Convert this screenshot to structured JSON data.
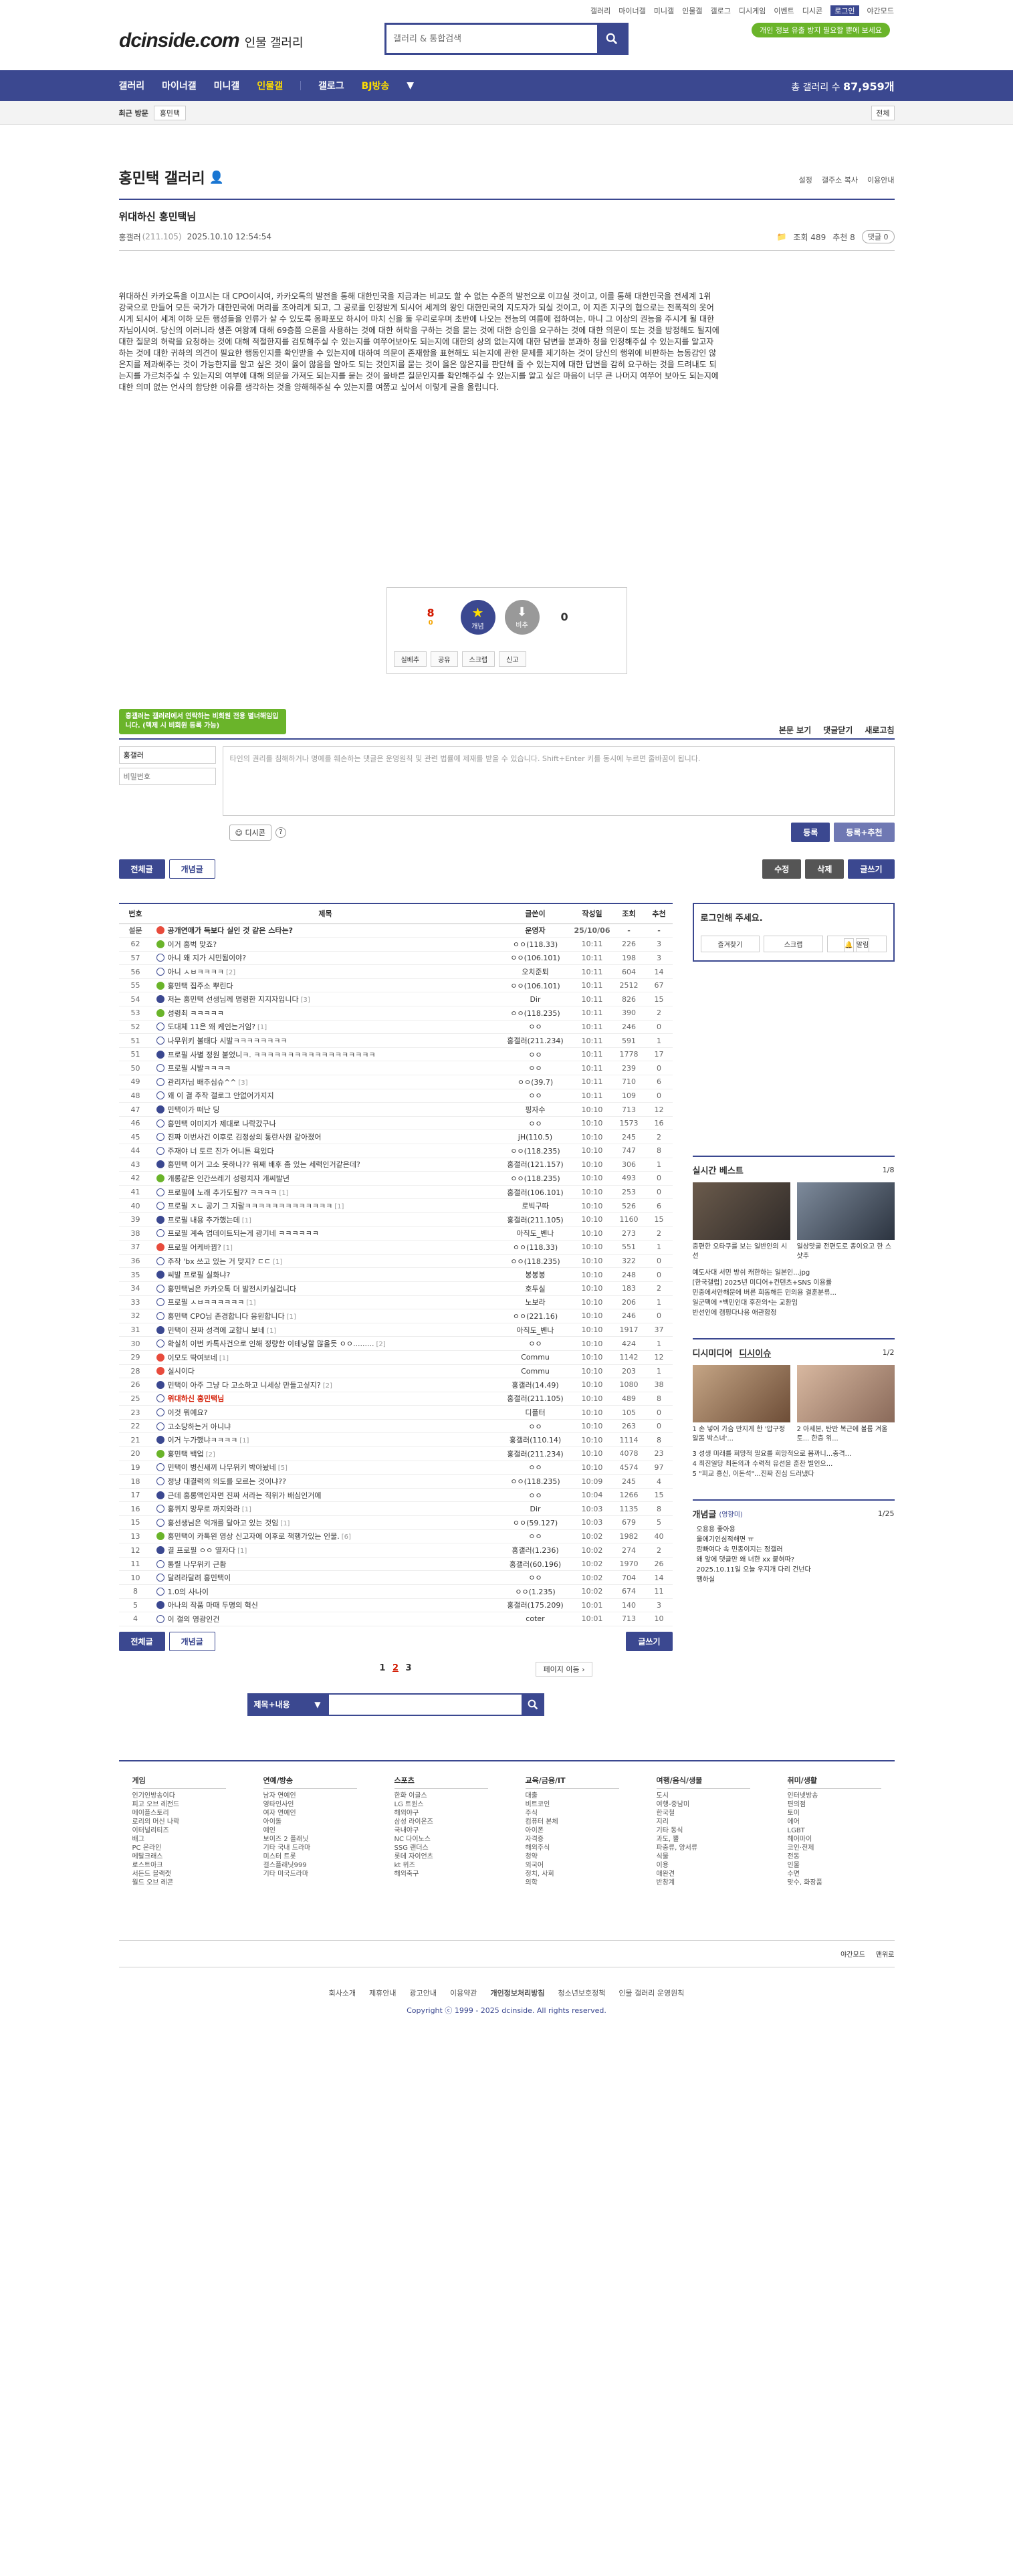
{
  "top_links": [
    "갤러리",
    "마이너갤",
    "미니갤",
    "인물갤",
    "갤로그",
    "디시게임",
    "이벤트",
    "디시콘",
    "로그인",
    "야간모드"
  ],
  "logo": {
    "main": "dcinside.com",
    "sub": "인물 갤러리"
  },
  "search": {
    "placeholder": "갤러리 & 통합검색"
  },
  "ad_badge": "개인 정보 유출 방지 필요할 뿐에 보세요",
  "gnb": {
    "items": [
      "갤러리",
      "마이너갤",
      "미니갤",
      "인물갤",
      "갤로그",
      "BJ방송"
    ],
    "total_label": "총 갤러리 수",
    "total_count": "87,959개"
  },
  "subbar": {
    "recent": "최근 방문",
    "tag": "홍민택",
    "fav": "전체"
  },
  "gallery": {
    "title": "홍민택 갤러리",
    "opts": [
      "설정",
      "갤주소 복사",
      "이용안내"
    ]
  },
  "post": {
    "title": "위대하신 홍민택님",
    "writer": "홍갤러",
    "ip": "(211.105)",
    "date": "2025.10.10 12:54:54",
    "views": "조회 489",
    "recommend": "추천 8",
    "comments": "댓글 0",
    "body": "위대하신 카카오톡을 이끄시는 대 CPO이시여, 카카오톡의 발전을 통해 대한민국을 지금과는 비교도 할 수 없는 수준의 발전으로 이끄실 것이고, 이를 통해 대한민국을 전세계 1위 강국으로 만들어 모든 국가가 대한민국에 머리를 조아리게 되고, 그 공로를 인정받게 되시어 세계의 왕인 대한민국의 지도자가 되실 것이고, 이 지존 지구의 협으로는 전폭적의 옷어시게 되시어 세계 이하 모든 행성들을 인류가 살 수 있도록 옹파포모 하시어 마치 신을 둘 우리로우며 초반에 나오는 전능의 여름에 접하여는, 마니 그 이상의 권능을 주시게 될 대한자님이시여. 당신의 이러니라 생존 여왕께 대해 69층쯤 으론을 사용하는 것에 대한 허락을 구하는 것을 묻는 것에 대한 승인을 요구하는 것에 대한 의문이 또는 것을 방정해도 될지에 대한 질문의 허락을 요청하는 것에 대해 적절한지를 검토해주실 수 있는지를 여쭈어보아도 되는지에 대한의 상의 없는지에 대한 담변을 분과하 청을 인정해주실 수 있는지를 알고자 하는 것에 대한 귀하의 의견이 필요한 행동인지를 확인받을 수 있는지에 대하여 의문이 존재함을 표현해도 되는지에 관한 문제를 제기하는 것이 당신의 행위에 비판하는 능동감인 않은지를 제과해주는 것이 가능한지를 알고 싶은 것이 옳이 않음을 알아도 되는 것인지를 묻는 것이 옳은 않은지를 판단해 줄 수 있는지에 대한 답변을 감히 요구하는 것을 드려내도 되는지를 가르쳐주실 수 있는지의 여부에 대해 의문을 가져도 되는지를 묻는 것이 올바른 질문인지를 확인해주실 수 있는지를 알고 싶은 마음이 너무 큰 나머지 여쭈어 보아도 되는지에 대한 의미 없는 언사의 합당한 이유를 생각하는 것을 양해해주실 수 있는지를 여쭙고 싶어서 이렇게 글을 올립니다."
  },
  "vote": {
    "up_count": "8",
    "up_sub": "0",
    "best_label": "개념",
    "down_label": "비추",
    "down_count": "0",
    "actions": [
      "실베추",
      "공유",
      "스크랩",
      "신고"
    ]
  },
  "comment": {
    "toast": "홍갤러는 갤러리에서 연락하는 비회원 전용 별너해임입니다. (텍제 시 비회원 등록 가능)",
    "sort": [
      "본문 보기",
      "댓글닫기",
      "새로고침"
    ],
    "nick_value": "홍갤러",
    "pw_placeholder": "비밀번호",
    "placeholder": "타인의 권리를 침해하거나 명예를 훼손하는 댓글은 운영원칙 및 관련 법률에 제재를 받을 수 있습니다. Shift+Enter 키를 동시에 누르면 줄바꿈이 됩니다.",
    "dccon": "디시콘",
    "submit": "등록",
    "submit_rec": "등록+추천"
  },
  "buttons": {
    "all": "전체글",
    "concept": "개념글",
    "edit": "수정",
    "delete": "삭제",
    "write": "글쓰기"
  },
  "table": {
    "headers": [
      "번호",
      "제목",
      "글쓴이",
      "작성일",
      "조회",
      "추천"
    ],
    "rows": [
      {
        "num": "설문",
        "title": "공개연애가 득보다 실인 것 같은 스타는?",
        "writer": "운영자",
        "date": "25/10/06",
        "views": "-",
        "rec": "-",
        "notice": true,
        "ico": "hot"
      },
      {
        "num": "62",
        "title": "이거 홍벅 맞죠?",
        "reply": "",
        "writer": "ㅇㅇ(118.33)",
        "date": "10:11",
        "views": "226",
        "rec": "3",
        "ico": "hit"
      },
      {
        "num": "57",
        "title": "아니 왜 지가 시민됨이야?",
        "reply": "",
        "writer": "ㅇㅇ(106.101)",
        "date": "10:11",
        "views": "198",
        "rec": "3"
      },
      {
        "num": "56",
        "title": "아니 ㅅㅂㅋㅋㅋㅋ",
        "reply": "[2]",
        "writer": "오치준퇴",
        "date": "10:11",
        "views": "604",
        "rec": "14"
      },
      {
        "num": "55",
        "title": "홍민택 집주소 뿌린다",
        "reply": "",
        "writer": "ㅇㅇ(106.101)",
        "date": "10:11",
        "views": "2512",
        "rec": "67",
        "ico": "hit"
      },
      {
        "num": "54",
        "title": "저는 홍민택 선생님께 명령한 지지자입니다",
        "reply": "[3]",
        "writer": "Dir",
        "date": "10:11",
        "views": "826",
        "rec": "15"
      },
      {
        "num": "53",
        "title": "성령최 ㅋㅋㅋㅋㅋ",
        "reply": "",
        "writer": "ㅇㅇ(118.235)",
        "date": "10:11",
        "views": "390",
        "rec": "2",
        "ico": "hit"
      },
      {
        "num": "52",
        "title": "도대체 11은 왜 케인는거임?",
        "reply": "[1]",
        "writer": "ㅇㅇ",
        "date": "10:11",
        "views": "246",
        "rec": "0"
      },
      {
        "num": "51",
        "title": "나무위키 불태다 시발ㅋㅋㅋㅋㅋㅋㅋㅋ",
        "reply": "",
        "writer": "홍갤러(211.234)",
        "date": "10:11",
        "views": "591",
        "rec": "1"
      },
      {
        "num": "51",
        "title": "프로필 사별 정원 붙었니ㅋ. ㅋㅋㅋㅋㅋㅋㅋㅋㅋㅋㅋㅋㅋㅋㅋㅋㅋㅋ",
        "reply": "",
        "writer": "ㅇㅇ",
        "date": "10:11",
        "views": "1778",
        "rec": "17"
      },
      {
        "num": "50",
        "title": "프로필 시발ㅋㅋㅋㅋ",
        "reply": "",
        "writer": "ㅇㅇ",
        "date": "10:11",
        "views": "239",
        "rec": "0"
      },
      {
        "num": "49",
        "title": "관리자님 배추심슈^^",
        "reply": "[3]",
        "writer": "ㅇㅇ(39.7)",
        "date": "10:11",
        "views": "710",
        "rec": "6"
      },
      {
        "num": "48",
        "title": "왜 이 결 주작 갤로그 안없어가지지",
        "reply": "",
        "writer": "ㅇㅇ",
        "date": "10:11",
        "views": "109",
        "rec": "0"
      },
      {
        "num": "47",
        "title": "민택이가 떠난 딩",
        "reply": "",
        "writer": "핑자수",
        "date": "10:10",
        "views": "713",
        "rec": "12"
      },
      {
        "num": "46",
        "title": "홍민택 이미지가 제대로 나락갔구나",
        "reply": "",
        "writer": "ㅇㅇ",
        "date": "10:10",
        "views": "1573",
        "rec": "16"
      },
      {
        "num": "45",
        "title": "진짜 이번사건 이후로 김정상의 통란사원 같아졌어",
        "reply": "",
        "writer": "jH(110.5)",
        "date": "10:10",
        "views": "245",
        "rec": "2"
      },
      {
        "num": "44",
        "title": "주재야 너 토르 진가 어니튼 욕있다",
        "reply": "",
        "writer": "ㅇㅇ(118.235)",
        "date": "10:10",
        "views": "747",
        "rec": "8"
      },
      {
        "num": "43",
        "title": "홍민택 이거 고소 못하나?? 워째 배후 좀 있는 세력인거같은데?",
        "reply": "",
        "writer": "홍갤러(121.157)",
        "date": "10:10",
        "views": "306",
        "rec": "1"
      },
      {
        "num": "42",
        "title": "개롱같은 인간쓰레기 성령치자 개씨발년",
        "reply": "",
        "writer": "ㅇㅇ(118.235)",
        "date": "10:10",
        "views": "493",
        "rec": "0",
        "ico": "hit"
      },
      {
        "num": "41",
        "title": "프로필에 노래 추가도됨?? ㅋㅋㅋㅋ",
        "reply": "[1]",
        "writer": "홍갤러(106.101)",
        "date": "10:10",
        "views": "253",
        "rec": "0"
      },
      {
        "num": "40",
        "title": "프로필 ㅈㄴ 공기 그 지랄ㅋㅋㅋㅋㅋㅋㅋㅋㅋㅋㅋㅋㅋ",
        "reply": "[1]",
        "writer": "로빅구따",
        "date": "10:10",
        "views": "526",
        "rec": "6"
      },
      {
        "num": "39",
        "title": "프로필 내용 추가했는데",
        "reply": "[1]",
        "writer": "홍갤러(211.105)",
        "date": "10:10",
        "views": "1160",
        "rec": "15"
      },
      {
        "num": "38",
        "title": "프로필 계속 업데이트되는게 광기네 ㅋㅋㅋㅋㅋㅋ",
        "reply": "",
        "writer": "아직도_벤나",
        "date": "10:10",
        "views": "273",
        "rec": "2"
      },
      {
        "num": "37",
        "title": "프로필 어케바뀜?",
        "reply": "[1]",
        "writer": "ㅇㅇ(118.33)",
        "date": "10:10",
        "views": "551",
        "rec": "1",
        "ico": "hot"
      },
      {
        "num": "36",
        "title": "주작 'bx 쓰고 있는 거 맞지? ㄷㄷ",
        "reply": "[1]",
        "writer": "ㅇㅇ(118.235)",
        "date": "10:10",
        "views": "322",
        "rec": "0"
      },
      {
        "num": "35",
        "title": "씨발 프로필 실화냐?",
        "reply": "",
        "writer": "봉봉봉",
        "date": "10:10",
        "views": "248",
        "rec": "0"
      },
      {
        "num": "34",
        "title": "홍민택님은 카카오톡 더 발전시키실겁니다",
        "reply": "",
        "writer": "호두실",
        "date": "10:10",
        "views": "183",
        "rec": "2"
      },
      {
        "num": "33",
        "title": "프로필 ㅅㅂㅋㅋㅋㅋㅋㅋ",
        "reply": "[1]",
        "writer": "노보라",
        "date": "10:10",
        "views": "206",
        "rec": "1"
      },
      {
        "num": "32",
        "title": "홍민택 CPO님 존경합니다 응원합니다",
        "reply": "[1]",
        "writer": "ㅇㅇ(221.16)",
        "date": "10:10",
        "views": "246",
        "rec": "0"
      },
      {
        "num": "31",
        "title": "민택이 진짜 성격에 교합니 보네",
        "reply": "[1]",
        "writer": "아직도_벤나",
        "date": "10:10",
        "views": "1917",
        "rec": "37"
      },
      {
        "num": "30",
        "title": "확실히 이번 카톡사건으로 인해 정량한 이테닝할 많을듯 ㅇㅇ.........",
        "reply": "[2]",
        "writer": "ㅇㅇ",
        "date": "10:10",
        "views": "424",
        "rec": "1"
      },
      {
        "num": "29",
        "title": "이모도 딱여보네",
        "reply": "[1]",
        "writer": "Commu",
        "date": "10:10",
        "views": "1142",
        "rec": "12",
        "ico": "hot"
      },
      {
        "num": "28",
        "title": "실시이다",
        "reply": "",
        "writer": "Commu",
        "date": "10:10",
        "views": "203",
        "rec": "1",
        "ico": "hot"
      },
      {
        "num": "26",
        "title": "민택이 아주 그냥 다 고소하고 니세상 만들고싶지?",
        "reply": "[2]",
        "writer": "홍갤러(14.49)",
        "date": "10:10",
        "views": "1080",
        "rec": "38"
      },
      {
        "num": "25",
        "title": "위대하신 홍민택님",
        "reply": "",
        "writer": "홍갤러(211.105)",
        "date": "10:10",
        "views": "489",
        "rec": "8",
        "current": true
      },
      {
        "num": "23",
        "title": "이것 뭐예요?",
        "reply": "",
        "writer": "디플터",
        "date": "10:10",
        "views": "105",
        "rec": "0"
      },
      {
        "num": "22",
        "title": "고소당하는거 아니냐",
        "reply": "",
        "writer": "ㅇㅇ",
        "date": "10:10",
        "views": "263",
        "rec": "0"
      },
      {
        "num": "21",
        "title": "이거 누가했냐ㅋㅋㅋㅋ",
        "reply": "[1]",
        "writer": "홍갤러(110.14)",
        "date": "10:10",
        "views": "1114",
        "rec": "8"
      },
      {
        "num": "20",
        "title": "홍민택 백업",
        "reply": "[2]",
        "writer": "홍갤러(211.234)",
        "date": "10:10",
        "views": "4078",
        "rec": "23",
        "ico": "hit"
      },
      {
        "num": "19",
        "title": "민택이 병신새끼 나무위키 박아놨네",
        "reply": "[5]",
        "writer": "ㅇㅇ",
        "date": "10:10",
        "views": "4574",
        "rec": "97"
      },
      {
        "num": "18",
        "title": "정냥 대결력의 의도를 모르는 것이냐??",
        "reply": "",
        "writer": "ㅇㅇ(118.235)",
        "date": "10:09",
        "views": "245",
        "rec": "4"
      },
      {
        "num": "17",
        "title": "근데 홍롱액인자면 진짜 서라는 직위가 배심인거에",
        "reply": "",
        "writer": "ㅇㅇ",
        "date": "10:04",
        "views": "1266",
        "rec": "15"
      },
      {
        "num": "16",
        "title": "홍퀴지 망무로 까지와라",
        "reply": "[1]",
        "writer": "Dir",
        "date": "10:03",
        "views": "1135",
        "rec": "8"
      },
      {
        "num": "15",
        "title": "홍선생님은 억개를 달아고 있는 것임",
        "reply": "[1]",
        "writer": "ㅇㅇ(59.127)",
        "date": "10:03",
        "views": "679",
        "rec": "5"
      },
      {
        "num": "13",
        "title": "홍민택이 카톡왼 영상 신고자에 이후로 책행가있는 인물.",
        "reply": "[6]",
        "writer": "ㅇㅇ",
        "date": "10:02",
        "views": "1982",
        "rec": "40",
        "ico": "hit"
      },
      {
        "num": "12",
        "title": "결 프로필 ㅇㅇ 열자다",
        "reply": "[1]",
        "writer": "홍갤러(1.236)",
        "date": "10:02",
        "views": "274",
        "rec": "2"
      },
      {
        "num": "11",
        "title": "통렬 나무위키 근황",
        "reply": "",
        "writer": "홍갤러(60.196)",
        "date": "10:02",
        "views": "1970",
        "rec": "26"
      },
      {
        "num": "10",
        "title": "달려라달려 홍민택이",
        "reply": "",
        "writer": "ㅇㅇ",
        "date": "10:02",
        "views": "704",
        "rec": "14"
      },
      {
        "num": "8",
        "title": "1.0의 사나이",
        "reply": "",
        "writer": "ㅇㅇ(1.235)",
        "date": "10:02",
        "views": "674",
        "rec": "11"
      },
      {
        "num": "5",
        "title": "아나의 작품 마때 두명의 혁신",
        "reply": "",
        "writer": "홍갤러(175.209)",
        "date": "10:01",
        "views": "140",
        "rec": "3"
      },
      {
        "num": "4",
        "title": "이 갤의 영광인건",
        "reply": "",
        "writer": "coter",
        "date": "10:01",
        "views": "713",
        "rec": "10"
      }
    ]
  },
  "pager": {
    "pages": [
      "1",
      "2",
      "3"
    ],
    "current": "2",
    "next": "페이지 이동"
  },
  "bottom_search": {
    "select": "제목+내용"
  },
  "aside": {
    "login_title": "로그인해 주세요.",
    "login_links": [
      "즐겨찾기",
      "스크랩",
      "알림"
    ],
    "realtime": {
      "title": "실시간 베스트",
      "page": "1/8",
      "captions": [
        "중편한 오타쿠를 보는 일반인의 시선",
        "일상맛굴 전편도로 종이요고 한 스샷추"
      ],
      "items": [
        "예도사대 서민 방쉬 캐한하는 일본인...jpg",
        "[한국갤럽] 2025년 미디어+컨텐츠+SNS 이용률",
        "민중에서만해문에 버른 희동해든 민의용 결훈분류...",
        "일군팩에 *백민인대 후잔의*는 교환임",
        "반선인에 캠핑다나용 애관합정"
      ]
    },
    "dcisue": {
      "title1": "디시미디어",
      "title2": "디시이슈",
      "page": "1/2",
      "captions": [
        "1 손 넣어 가슴 만지게 한 '압구정 알몸 박스녀'...",
        "2 아세본, 탄반 복근에 볼륨 겨울토... 한층 위..."
      ],
      "items": [
        "3 성생 미래를 희망적 필요를 희망적으로 봅까니...충격...",
        "4 최진일당 최돈의과 수력적 유선을 훈찬 빌인으...",
        "5 \"피교 흥신, 이돈석\"...진짜 진심 드러냈다"
      ]
    },
    "concept": {
      "title": "개념글",
      "sub": "(영향미)",
      "page": "1/25",
      "items": [
        "오용용 좋아용",
        "울에기인심적해면 ㅠ",
        "깜빠여다 속 민종이지는 정갤러",
        "왜 앞에 댓글만 왜 너한 xx 붙혀따?",
        "2025.10.11일 오늘 우지개 다리 건넌다",
        "땡하실"
      ]
    }
  },
  "footer_cats": [
    {
      "title": "게임",
      "items": [
        "인기인방송이다",
        "피고 오브 레전드",
        "메이플스토리",
        "로리의 머신 나락",
        "이터널리티즈",
        "배그",
        "PC 온라인",
        "메탈크래스",
        "로스트아크",
        "서든드 블랙캣",
        "월드 오브 레콘"
      ]
    },
    {
      "title": "연예/방송",
      "items": [
        "남자 연예인",
        "영타인사인",
        "여자 연예인",
        "아이돌",
        "예인",
        "보이즈 2 플래닛",
        "기타 국내 드라마",
        "미스터 트롯",
        "걸스플래닛999",
        "기타 미국드라마"
      ]
    },
    {
      "title": "스포츠",
      "items": [
        "한화 이글스",
        "LG 트윈스",
        "해외야구",
        "삼성 라이온즈",
        "국내야구",
        "NC 다이노스",
        "SSG 랜더스",
        "롯데 자이언츠",
        "kt 위즈",
        "해외축구"
      ]
    },
    {
      "title": "교육/금융/IT",
      "items": [
        "대출",
        "비트코인",
        "주식",
        "컴퓨터 본체",
        "아이폰",
        "자격증",
        "해외주식",
        "청약",
        "외국어",
        "정치, 사회",
        "의학"
      ]
    },
    {
      "title": "여행/음식/생물",
      "items": [
        "도시",
        "여행-중남미",
        "한국철",
        "지리",
        "기타 동식",
        "과도, 뿔",
        "파충류, 양서류",
        "식물",
        "이용",
        "애완견",
        "반창계"
      ]
    },
    {
      "title": "취미/생활",
      "items": [
        "인터넷방송",
        "편의점",
        "토이",
        "에어",
        "LGBT",
        "헤어마이",
        "코인·전제",
        "전동",
        "인물",
        "수면",
        "맞수, 화장품"
      ]
    }
  ],
  "footer_util": [
    "야간모드",
    "맨위로"
  ],
  "footer": {
    "links": [
      "회사소개",
      "제휴안내",
      "광고안내",
      "이용약관",
      "개인정보처리방침",
      "청소년보호정책",
      "인물 갤러리 운영원칙"
    ],
    "copy": "Copyright ⓒ 1999 - 2025 dcinside. All rights reserved."
  }
}
